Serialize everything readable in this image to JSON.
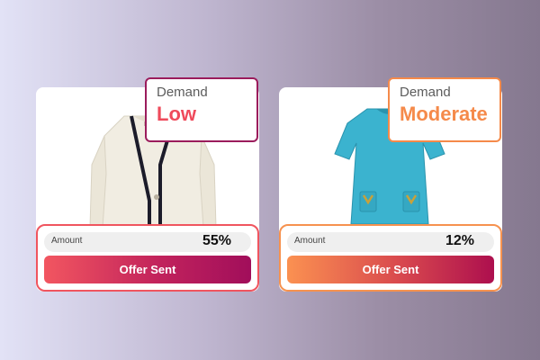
{
  "cards": [
    {
      "product_icon": "cardigan-icon",
      "demand": {
        "label": "Demand",
        "value": "Low"
      },
      "amount": {
        "label": "Amount",
        "value": "55%"
      },
      "offer_button": "Offer Sent",
      "colors": {
        "accent": "#ef4a5b",
        "border": "#9b1c5c"
      }
    },
    {
      "product_icon": "dress-icon",
      "demand": {
        "label": "Demand",
        "value": "Moderate"
      },
      "amount": {
        "label": "Amount",
        "value": "12%"
      },
      "offer_button": "Offer Sent",
      "colors": {
        "accent": "#f58a4a",
        "border": "#f58a4a"
      }
    }
  ]
}
